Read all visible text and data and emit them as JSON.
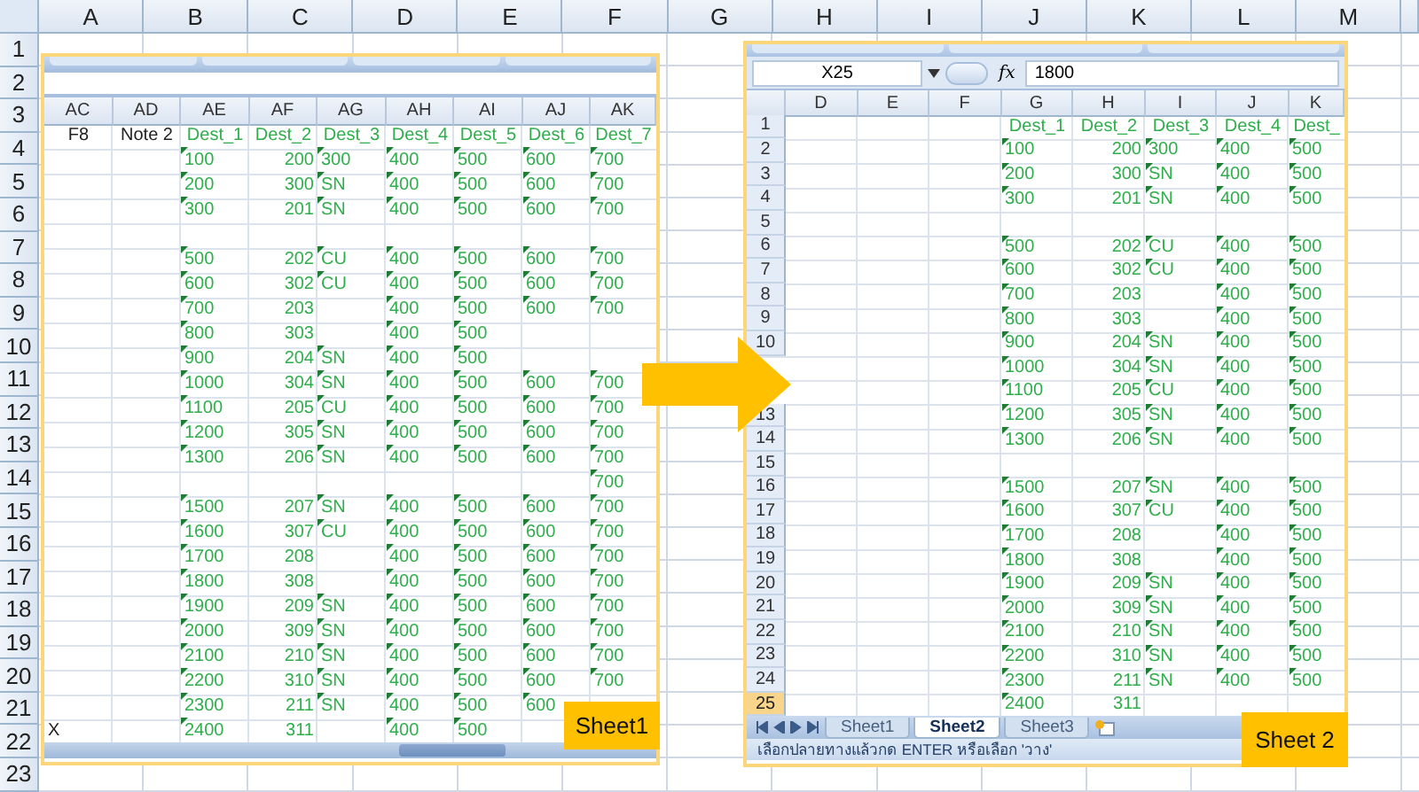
{
  "outer": {
    "columns": [
      "A",
      "B",
      "C",
      "D",
      "E",
      "F",
      "G",
      "H",
      "I",
      "J",
      "K",
      "L",
      "M"
    ],
    "rows": [
      "1",
      "2",
      "3",
      "4",
      "5",
      "6",
      "7",
      "8",
      "9",
      "10",
      "11",
      "12",
      "13",
      "14",
      "15",
      "16",
      "17",
      "18",
      "19",
      "20",
      "21",
      "22",
      "23"
    ]
  },
  "left_view": {
    "columns": [
      {
        "label": "AC",
        "kind": "plain"
      },
      {
        "label": "AD",
        "kind": "plain"
      },
      {
        "label": "AE",
        "kind": "text"
      },
      {
        "label": "AF",
        "kind": "number"
      },
      {
        "label": "AG",
        "kind": "text"
      },
      {
        "label": "AH",
        "kind": "text"
      },
      {
        "label": "AI",
        "kind": "text"
      },
      {
        "label": "AJ",
        "kind": "text"
      },
      {
        "label": "AK",
        "kind": "text"
      }
    ],
    "rows": [
      {
        "kind": "header",
        "cells": [
          "F8",
          "Note 2",
          "Dest_1",
          "Dest_2",
          "Dest_3",
          "Dest_4",
          "Dest_5",
          "Dest_6",
          "Dest_7"
        ]
      },
      {
        "kind": "data",
        "cells": [
          "",
          "",
          "100",
          "200",
          "300",
          "400",
          "500",
          "600",
          "700"
        ]
      },
      {
        "kind": "data",
        "cells": [
          "",
          "",
          "200",
          "300",
          "SN",
          "400",
          "500",
          "600",
          "700"
        ]
      },
      {
        "kind": "data",
        "cells": [
          "",
          "",
          "300",
          "201",
          "SN",
          "400",
          "500",
          "600",
          "700"
        ]
      },
      {
        "kind": "data",
        "cells": [
          "",
          "",
          "",
          "",
          "",
          "",
          "",
          "",
          ""
        ]
      },
      {
        "kind": "data",
        "cells": [
          "",
          "",
          "500",
          "202",
          "CU",
          "400",
          "500",
          "600",
          "700"
        ]
      },
      {
        "kind": "data",
        "cells": [
          "",
          "",
          "600",
          "302",
          "CU",
          "400",
          "500",
          "600",
          "700"
        ]
      },
      {
        "kind": "data",
        "cells": [
          "",
          "",
          "700",
          "203",
          "",
          "400",
          "500",
          "600",
          "700"
        ]
      },
      {
        "kind": "data",
        "cells": [
          "",
          "",
          "800",
          "303",
          "",
          "400",
          "500",
          "",
          ""
        ]
      },
      {
        "kind": "data",
        "cells": [
          "",
          "",
          "900",
          "204",
          "SN",
          "400",
          "500",
          "",
          ""
        ]
      },
      {
        "kind": "data",
        "cells": [
          "",
          "",
          "1000",
          "304",
          "SN",
          "400",
          "500",
          "600",
          "700"
        ]
      },
      {
        "kind": "data",
        "cells": [
          "",
          "",
          "1100",
          "205",
          "CU",
          "400",
          "500",
          "600",
          "700"
        ]
      },
      {
        "kind": "data",
        "cells": [
          "",
          "",
          "1200",
          "305",
          "SN",
          "400",
          "500",
          "600",
          "700"
        ]
      },
      {
        "kind": "data",
        "cells": [
          "",
          "",
          "1300",
          "206",
          "SN",
          "400",
          "500",
          "600",
          "700"
        ]
      },
      {
        "kind": "data",
        "cells": [
          "",
          "",
          "",
          "",
          "",
          "",
          "",
          "",
          "700"
        ]
      },
      {
        "kind": "data",
        "cells": [
          "",
          "",
          "1500",
          "207",
          "SN",
          "400",
          "500",
          "600",
          "700"
        ]
      },
      {
        "kind": "data",
        "cells": [
          "",
          "",
          "1600",
          "307",
          "CU",
          "400",
          "500",
          "600",
          "700"
        ]
      },
      {
        "kind": "data",
        "cells": [
          "",
          "",
          "1700",
          "208",
          "",
          "400",
          "500",
          "600",
          "700"
        ]
      },
      {
        "kind": "data",
        "cells": [
          "",
          "",
          "1800",
          "308",
          "",
          "400",
          "500",
          "600",
          "700"
        ]
      },
      {
        "kind": "data",
        "cells": [
          "",
          "",
          "1900",
          "209",
          "SN",
          "400",
          "500",
          "600",
          "700"
        ]
      },
      {
        "kind": "data",
        "cells": [
          "",
          "",
          "2000",
          "309",
          "SN",
          "400",
          "500",
          "600",
          "700"
        ]
      },
      {
        "kind": "data",
        "cells": [
          "",
          "",
          "2100",
          "210",
          "SN",
          "400",
          "500",
          "600",
          "700"
        ]
      },
      {
        "kind": "data",
        "cells": [
          "",
          "",
          "2200",
          "310",
          "SN",
          "400",
          "500",
          "600",
          "700"
        ]
      },
      {
        "kind": "data",
        "cells": [
          "",
          "",
          "2300",
          "211",
          "SN",
          "400",
          "500",
          "600",
          ""
        ]
      },
      {
        "kind": "data",
        "cells": [
          "X",
          "",
          "2400",
          "311",
          "",
          "400",
          "500",
          "",
          ""
        ]
      }
    ],
    "caption": "Sheet1"
  },
  "right_view": {
    "name_box": "X25",
    "function_label": "fx",
    "formula": "1800",
    "columns": [
      {
        "label": "D",
        "kind": "plain"
      },
      {
        "label": "E",
        "kind": "plain"
      },
      {
        "label": "F",
        "kind": "plain"
      },
      {
        "label": "G",
        "kind": "text"
      },
      {
        "label": "H",
        "kind": "number"
      },
      {
        "label": "I",
        "kind": "text"
      },
      {
        "label": "J",
        "kind": "text"
      },
      {
        "label": "K",
        "kind": "text"
      }
    ],
    "rows": [
      {
        "number": "1",
        "selected": false,
        "kind": "header",
        "cells": [
          "",
          "",
          "",
          "Dest_1",
          "Dest_2",
          "Dest_3",
          "Dest_4",
          "Dest_"
        ]
      },
      {
        "number": "2",
        "selected": false,
        "kind": "data",
        "cells": [
          "",
          "",
          "",
          "100",
          "200",
          "300",
          "400",
          "500"
        ]
      },
      {
        "number": "3",
        "selected": false,
        "kind": "data",
        "cells": [
          "",
          "",
          "",
          "200",
          "300",
          "SN",
          "400",
          "500"
        ]
      },
      {
        "number": "4",
        "selected": false,
        "kind": "data",
        "cells": [
          "",
          "",
          "",
          "300",
          "201",
          "SN",
          "400",
          "500"
        ]
      },
      {
        "number": "5",
        "selected": false,
        "kind": "data",
        "cells": [
          "",
          "",
          "",
          "",
          "",
          "",
          "",
          ""
        ]
      },
      {
        "number": "6",
        "selected": false,
        "kind": "data",
        "cells": [
          "",
          "",
          "",
          "500",
          "202",
          "CU",
          "400",
          "500"
        ]
      },
      {
        "number": "7",
        "selected": false,
        "kind": "data",
        "cells": [
          "",
          "",
          "",
          "600",
          "302",
          "CU",
          "400",
          "500"
        ]
      },
      {
        "number": "8",
        "selected": false,
        "kind": "data",
        "cells": [
          "",
          "",
          "",
          "700",
          "203",
          "",
          "400",
          "500"
        ]
      },
      {
        "number": "9",
        "selected": false,
        "kind": "data",
        "cells": [
          "",
          "",
          "",
          "800",
          "303",
          "",
          "400",
          "500"
        ]
      },
      {
        "number": "10",
        "selected": false,
        "kind": "data",
        "cells": [
          "",
          "",
          "",
          "900",
          "204",
          "SN",
          "400",
          "500"
        ]
      },
      {
        "kind": "data",
        "cells": [
          "",
          "",
          "",
          "1000",
          "304",
          "SN",
          "400",
          "500"
        ]
      },
      {
        "kind": "data",
        "cells": [
          "",
          "",
          "",
          "1100",
          "205",
          "CU",
          "400",
          "500"
        ]
      },
      {
        "number": "13",
        "selected": false,
        "kind": "data",
        "cells": [
          "",
          "",
          "",
          "1200",
          "305",
          "SN",
          "400",
          "500"
        ]
      },
      {
        "number": "14",
        "selected": false,
        "kind": "data",
        "cells": [
          "",
          "",
          "",
          "1300",
          "206",
          "SN",
          "400",
          "500"
        ]
      },
      {
        "number": "15",
        "selected": false,
        "kind": "data",
        "cells": [
          "",
          "",
          "",
          "",
          "",
          "",
          "",
          ""
        ]
      },
      {
        "number": "16",
        "selected": false,
        "kind": "data",
        "cells": [
          "",
          "",
          "",
          "1500",
          "207",
          "SN",
          "400",
          "500"
        ]
      },
      {
        "number": "17",
        "selected": false,
        "kind": "data",
        "cells": [
          "",
          "",
          "",
          "1600",
          "307",
          "CU",
          "400",
          "500"
        ]
      },
      {
        "number": "18",
        "selected": false,
        "kind": "data",
        "cells": [
          "",
          "",
          "",
          "1700",
          "208",
          "",
          "400",
          "500"
        ]
      },
      {
        "number": "19",
        "selected": false,
        "kind": "data",
        "cells": [
          "",
          "",
          "",
          "1800",
          "308",
          "",
          "400",
          "500"
        ]
      },
      {
        "number": "20",
        "selected": false,
        "kind": "data",
        "cells": [
          "",
          "",
          "",
          "1900",
          "209",
          "SN",
          "400",
          "500"
        ]
      },
      {
        "number": "21",
        "selected": false,
        "kind": "data",
        "cells": [
          "",
          "",
          "",
          "2000",
          "309",
          "SN",
          "400",
          "500"
        ]
      },
      {
        "number": "22",
        "selected": false,
        "kind": "data",
        "cells": [
          "",
          "",
          "",
          "2100",
          "210",
          "SN",
          "400",
          "500"
        ]
      },
      {
        "number": "23",
        "selected": false,
        "kind": "data",
        "cells": [
          "",
          "",
          "",
          "2200",
          "310",
          "SN",
          "400",
          "500"
        ]
      },
      {
        "number": "24",
        "selected": false,
        "kind": "data",
        "cells": [
          "",
          "",
          "",
          "2300",
          "211",
          "SN",
          "400",
          "500"
        ]
      },
      {
        "number": "25",
        "selected": true,
        "kind": "data",
        "cells": [
          "",
          "",
          "",
          "2400",
          "311",
          "",
          "",
          ""
        ]
      }
    ],
    "tabs": [
      {
        "label": "Sheet1",
        "selected": false
      },
      {
        "label": "Sheet2",
        "selected": true
      },
      {
        "label": "Sheet3",
        "selected": false
      }
    ],
    "status_text": "เลือกปลายทางแล้วกด ENTER หรือเลือก 'วาง'",
    "caption": "Sheet 2"
  }
}
